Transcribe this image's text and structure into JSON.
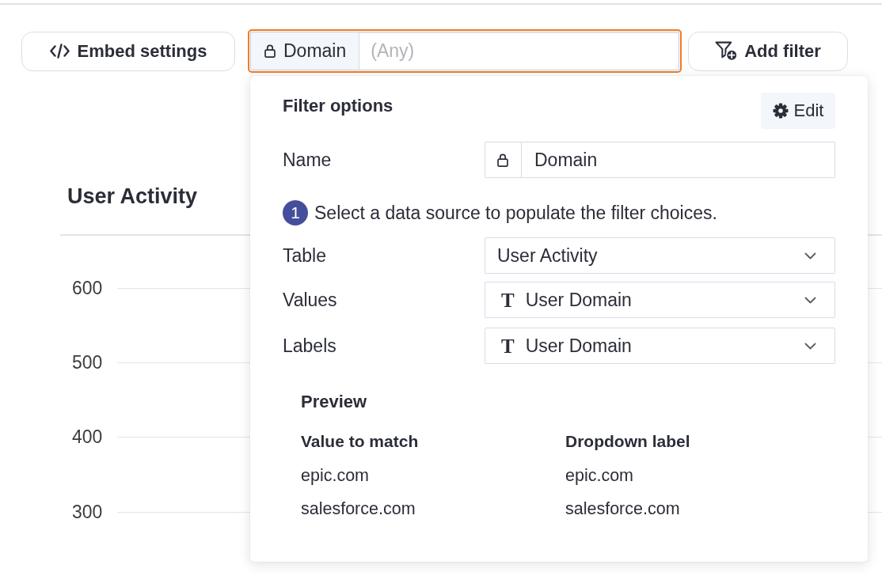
{
  "toolbar": {
    "embed_button": {
      "label": "Embed settings"
    },
    "filter_chip": {
      "name": "Domain",
      "locked": true,
      "placeholder": "(Any)",
      "focused": true
    },
    "add_filter_button": {
      "label": "Add filter"
    }
  },
  "chart": {
    "title": "User Activity",
    "y_axis_labels": [
      "600",
      "500",
      "400",
      "300"
    ]
  },
  "filter_popover": {
    "title": "Filter options",
    "edit_button": {
      "label": "Edit"
    },
    "name_field": {
      "label": "Name",
      "value": "Domain",
      "locked": true
    },
    "step": {
      "number": "1",
      "text": "Select a data source to populate the filter choices."
    },
    "selects": [
      {
        "label": "Table",
        "value": "User Activity"
      },
      {
        "label": "Values",
        "value": "User Domain",
        "type_icon": "T"
      },
      {
        "label": "Labels",
        "value": "User Domain",
        "type_icon": "T"
      }
    ],
    "preview": {
      "title": "Preview",
      "columns": [
        "Value to match",
        "Dropdown label"
      ],
      "rows": [
        [
          "epic.com",
          "epic.com"
        ],
        [
          "salesforce.com",
          "salesforce.com"
        ]
      ]
    }
  }
}
